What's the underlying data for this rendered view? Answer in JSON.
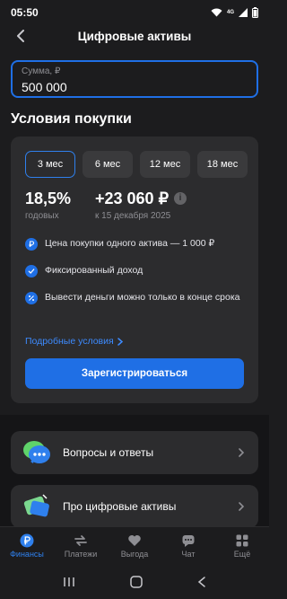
{
  "status_bar": {
    "time": "05:50",
    "network": "4G"
  },
  "header": {
    "title": "Цифровые активы"
  },
  "amount": {
    "label": "Сумма, ₽",
    "value": "500 000"
  },
  "section": {
    "title": "Условия покупки"
  },
  "terms": {
    "options": [
      "3 мес",
      "6 мес",
      "12 мес",
      "18 мес"
    ],
    "selected": "3 мес"
  },
  "rate": {
    "value": "18,5%",
    "caption": "годовых"
  },
  "income": {
    "value": "+23 060 ₽",
    "caption": "к 15 декабря 2025",
    "info_icon": "i"
  },
  "features": [
    {
      "icon": "ruble-coin-icon",
      "text": "Цена покупки одного актива — 1 000 ₽"
    },
    {
      "icon": "check-icon",
      "text": "Фиксированный доход"
    },
    {
      "icon": "percent-icon",
      "text": "Вывести деньги можно только в конце срока"
    }
  ],
  "details_link": "Подробные условия",
  "register_button": "Зарегистрироваться",
  "list_items": [
    {
      "label": "Вопросы и ответы",
      "icon": "chat-bubbles-icon"
    },
    {
      "label": "Про цифровые активы",
      "icon": "money-tag-icon"
    }
  ],
  "tabs": [
    {
      "label": "Финансы",
      "icon": "ruble-icon",
      "active": true
    },
    {
      "label": "Платежи",
      "icon": "arrows-icon",
      "active": false
    },
    {
      "label": "Выгода",
      "icon": "heart-icon",
      "active": false
    },
    {
      "label": "Чат",
      "icon": "chat-icon",
      "active": false
    },
    {
      "label": "Ещё",
      "icon": "grid-icon",
      "active": false
    }
  ],
  "colors": {
    "accent": "#1f6fe5",
    "background": "#1c1c1e",
    "card": "#2c2c2e",
    "link": "#3d8bff"
  }
}
